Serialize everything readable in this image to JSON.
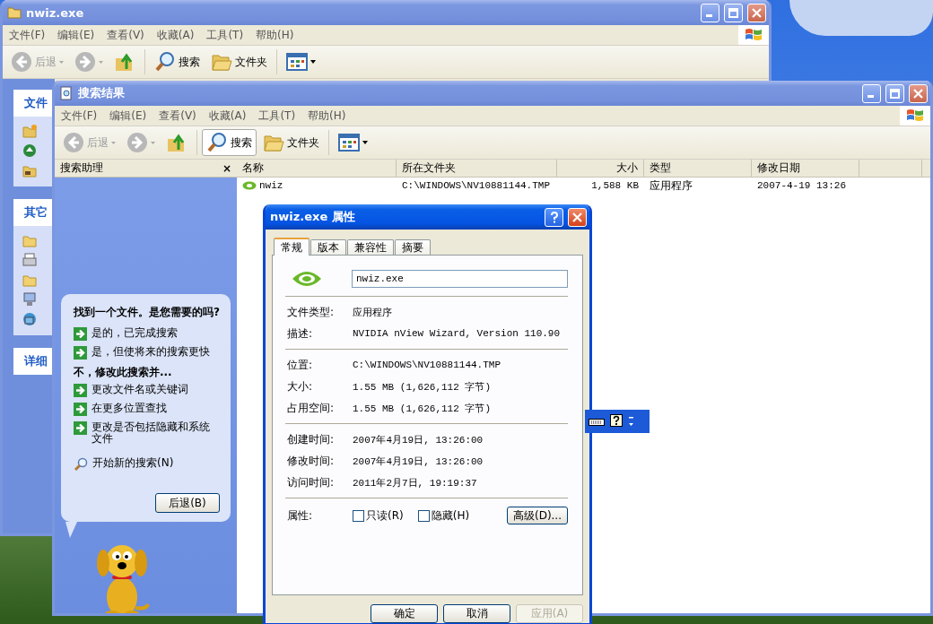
{
  "back_window": {
    "title": "nwiz.exe",
    "active": false,
    "menu": [
      "文件(F)",
      "编辑(E)",
      "查看(V)",
      "收藏(A)",
      "工具(T)",
      "帮助(H)"
    ],
    "toolbar": [
      {
        "kind": "back",
        "label": "后退",
        "disabled": true
      },
      {
        "kind": "forward",
        "disabled": true
      },
      {
        "kind": "up"
      },
      {
        "kind": "search",
        "label": "搜索",
        "pressed": false
      },
      {
        "kind": "folders",
        "label": "文件夹"
      },
      {
        "kind": "views"
      }
    ],
    "task_panes": [
      {
        "title": "文件",
        "items": [
          {
            "kind": "new-folder"
          },
          {
            "kind": "globe"
          },
          {
            "kind": "shared-folder"
          }
        ]
      },
      {
        "title": "其它",
        "items": [
          {
            "kind": "folder"
          },
          {
            "kind": "printer"
          },
          {
            "kind": "folder"
          },
          {
            "kind": "computer"
          },
          {
            "kind": "network"
          }
        ]
      },
      {
        "title": "详细"
      }
    ]
  },
  "search_window": {
    "title": "搜索结果",
    "active": false,
    "menu": [
      "文件(F)",
      "编辑(E)",
      "查看(V)",
      "收藏(A)",
      "工具(T)",
      "帮助(H)"
    ],
    "toolbar": [
      {
        "kind": "back",
        "label": "后退",
        "disabled": true
      },
      {
        "kind": "forward",
        "disabled": true
      },
      {
        "kind": "up"
      },
      {
        "kind": "search",
        "label": "搜索",
        "pressed": true
      },
      {
        "kind": "folders",
        "label": "文件夹"
      },
      {
        "kind": "views"
      }
    ],
    "assistant": {
      "title": "搜索助理",
      "close": "×",
      "question": "找到一个文件。是您需要的吗?",
      "options": [
        {
          "kind": "action",
          "label": "是的，已完成搜索"
        },
        {
          "kind": "action",
          "label": "是，但使将来的搜索更快"
        },
        {
          "kind": "heading",
          "label": "不，修改此搜索并..."
        },
        {
          "kind": "action",
          "label": "更改文件名或关键词"
        },
        {
          "kind": "action",
          "label": "在更多位置查找"
        },
        {
          "kind": "action",
          "label": "更改是否包括隐藏和系统文件"
        },
        {
          "kind": "search",
          "label": "开始新的搜索(N)"
        }
      ],
      "back_button": "后退(B)"
    },
    "results": {
      "columns": [
        "名称",
        "所在文件夹",
        "大小",
        "类型",
        "修改日期"
      ],
      "rows": [
        {
          "name": "nwiz",
          "folder": "C:\\WINDOWS\\NV10881144.TMP",
          "size": "1,588 KB",
          "type": "应用程序",
          "modified": "2007-4-19 13:26"
        }
      ]
    }
  },
  "dialog": {
    "title": "nwiz.exe 属性",
    "active": true,
    "tabs": [
      {
        "label": "常规",
        "selected": true
      },
      {
        "label": "版本",
        "selected": false
      },
      {
        "label": "兼容性",
        "selected": false
      },
      {
        "label": "摘要",
        "selected": false
      }
    ],
    "file_name": "nwiz.exe",
    "groups": [
      [
        {
          "label": "文件类型:",
          "value": "应用程序"
        },
        {
          "label": "描述:",
          "value": "NVIDIA nView Wizard, Version 110.90"
        }
      ],
      [
        {
          "label": "位置:",
          "value": "C:\\WINDOWS\\NV10881144.TMP"
        },
        {
          "label": "大小:",
          "value": "1.55 MB (1,626,112 字节)"
        },
        {
          "label": "占用空间:",
          "value": "1.55 MB (1,626,112 字节)"
        }
      ],
      [
        {
          "label": "创建时间:",
          "value": "2007年4月19日, 13:26:00"
        },
        {
          "label": "修改时间:",
          "value": "2007年4月19日, 13:26:00"
        },
        {
          "label": "访问时间:",
          "value": "2011年2月7日, 19:19:37"
        }
      ]
    ],
    "attributes": {
      "label": "属性:",
      "checkboxes": [
        {
          "label": "只读(R)",
          "checked": false
        },
        {
          "label": "隐藏(H)",
          "checked": false
        }
      ],
      "advanced": "高级(D)..."
    },
    "buttons": [
      {
        "label": "确定",
        "disabled": false
      },
      {
        "label": "取消",
        "disabled": false
      },
      {
        "label": "应用(A)",
        "disabled": true
      }
    ]
  }
}
